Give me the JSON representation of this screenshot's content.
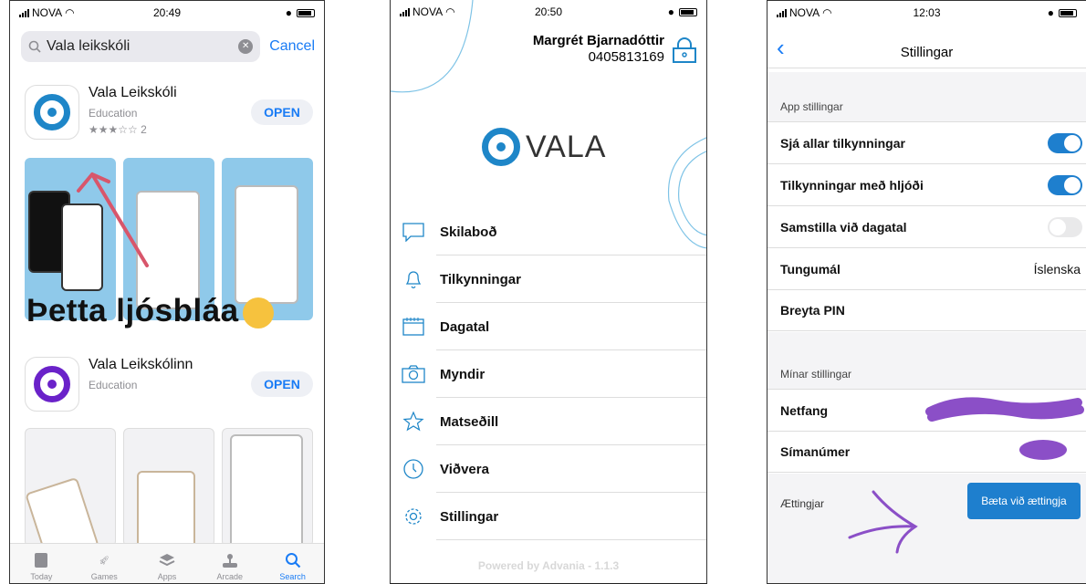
{
  "phone1": {
    "status": {
      "carrier": "NOVA",
      "time": "20:49"
    },
    "search": {
      "query": "Vala leikskóli",
      "cancel": "Cancel"
    },
    "apps": [
      {
        "name": "Vala Leikskóli",
        "category": "Education",
        "rating": "★★★☆☆ 2",
        "button": "OPEN"
      },
      {
        "name": "Vala Leikskólinn",
        "category": "Education",
        "button": "OPEN"
      }
    ],
    "overlay_text": "Þetta ljósbláa",
    "tabs": [
      "Today",
      "Games",
      "Apps",
      "Arcade",
      "Search"
    ],
    "active_tab": "Search"
  },
  "phone2": {
    "status": {
      "carrier": "NOVA",
      "time": "20:50"
    },
    "user": {
      "name": "Margrét Bjarnadóttir",
      "phone": "0405813169"
    },
    "logo_text": "VALA",
    "menu": [
      {
        "label": "Skilaboð",
        "icon": "chat-bubble-icon"
      },
      {
        "label": "Tilkynningar",
        "icon": "bell-icon"
      },
      {
        "label": "Dagatal",
        "icon": "calendar-icon"
      },
      {
        "label": "Myndir",
        "icon": "camera-icon"
      },
      {
        "label": "Matseðill",
        "icon": "star-icon"
      },
      {
        "label": "Viðvera",
        "icon": "clock-icon"
      },
      {
        "label": "Stillingar",
        "icon": "gear-icon"
      }
    ],
    "footer": "Powered by Advania - 1.1.3"
  },
  "phone3": {
    "status": {
      "carrier": "NOVA",
      "time": "12:03"
    },
    "title": "Stillingar",
    "section1": "App stillingar",
    "rows": {
      "see_all": {
        "label": "Sjá allar tilkynningar",
        "on": true
      },
      "sound": {
        "label": "Tilkynningar með hljóði",
        "on": true
      },
      "calendar": {
        "label": "Samstilla við dagatal",
        "on": false
      },
      "language": {
        "label": "Tungumál",
        "value": "Íslenska"
      },
      "pin": {
        "label": "Breyta PIN"
      }
    },
    "section2": "Mínar stillingar",
    "email_label": "Netfang",
    "phone_label": "Símanúmer",
    "relatives_label": "Ættingjar",
    "add_button": "Bæta við ættingja"
  },
  "colors": {
    "ios_blue": "#1a7cf5",
    "vala_blue": "#1e86c8",
    "vala_purple": "#6a22c9",
    "scribble": "#8b4fc7",
    "arrow_red": "#d8566b"
  }
}
